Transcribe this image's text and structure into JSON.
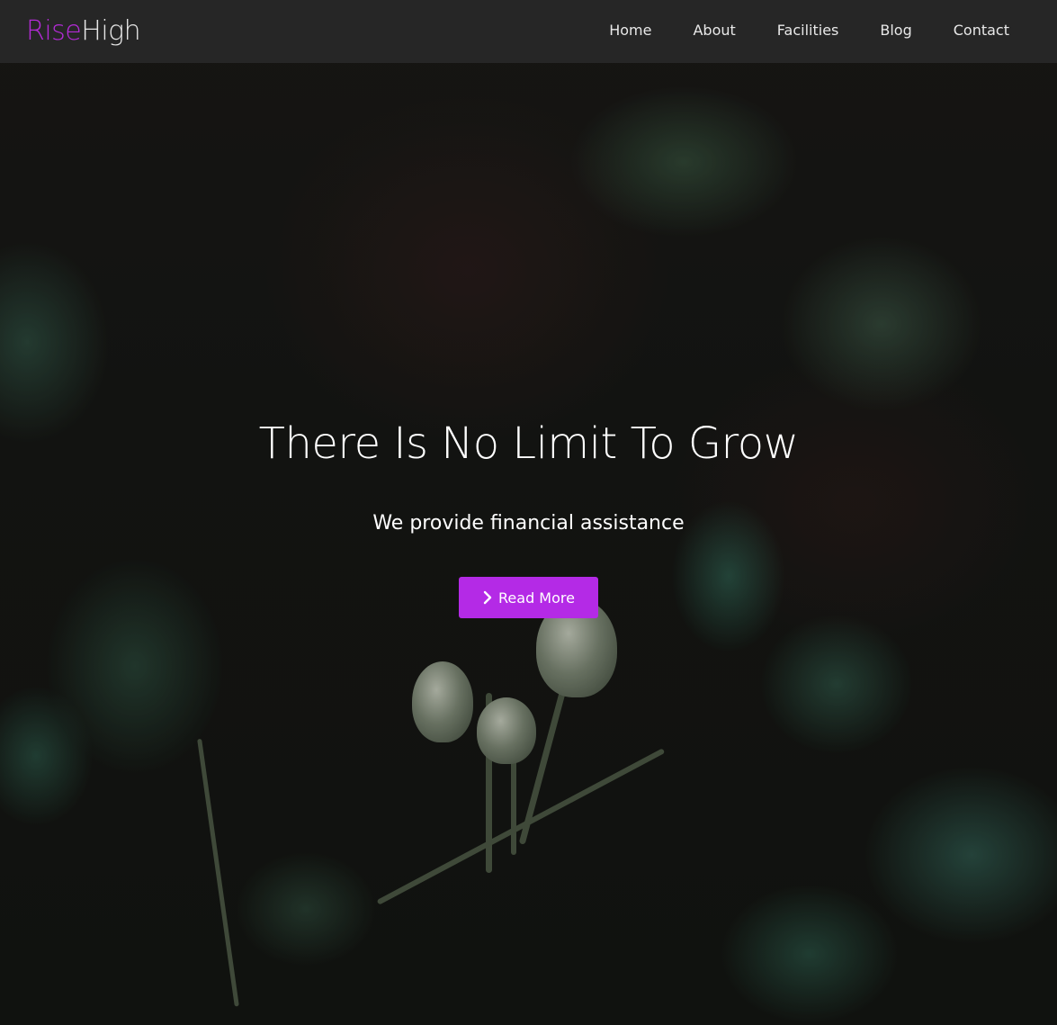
{
  "navbar": {
    "brand": {
      "part1": "Rise",
      "part2": "High"
    },
    "links": [
      {
        "label": "Home"
      },
      {
        "label": "About"
      },
      {
        "label": "Facilities"
      },
      {
        "label": "Blog"
      },
      {
        "label": "Contact"
      }
    ]
  },
  "hero": {
    "title": "There Is No Limit To Grow",
    "subtitle": "We provide financial assistance",
    "button": {
      "label": "Read More",
      "icon": "chevron-right-icon"
    }
  },
  "colors": {
    "brand_accent": "#b32bd6",
    "button_bg": "#b42ae6",
    "navbar_bg": "#282828"
  }
}
